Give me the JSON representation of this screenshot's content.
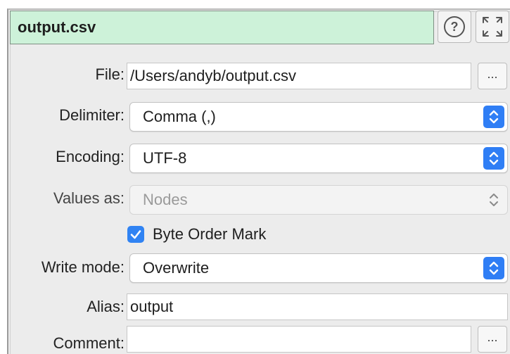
{
  "panel": {
    "title": "output.csv",
    "help_icon_glyph": "?"
  },
  "fields": {
    "file": {
      "label": "File:",
      "value": "/Users/andyb/output.csv",
      "browse_label": "..."
    },
    "delimiter": {
      "label": "Delimiter:",
      "value": "Comma (,)"
    },
    "encoding": {
      "label": "Encoding:",
      "value": "UTF-8"
    },
    "values_as": {
      "label": "Values as:",
      "value": "Nodes",
      "disabled": true
    },
    "byte_order_mark": {
      "label": "Byte Order Mark",
      "checked": true
    },
    "write_mode": {
      "label": "Write mode:",
      "value": "Overwrite"
    },
    "alias": {
      "label": "Alias:",
      "value": "output"
    },
    "comment": {
      "label": "Comment:",
      "value": "",
      "browse_label": "..."
    }
  },
  "colors": {
    "title_bg": "#cdf2d9",
    "accent": "#2f7ef5",
    "panel_bg": "#ececec"
  }
}
